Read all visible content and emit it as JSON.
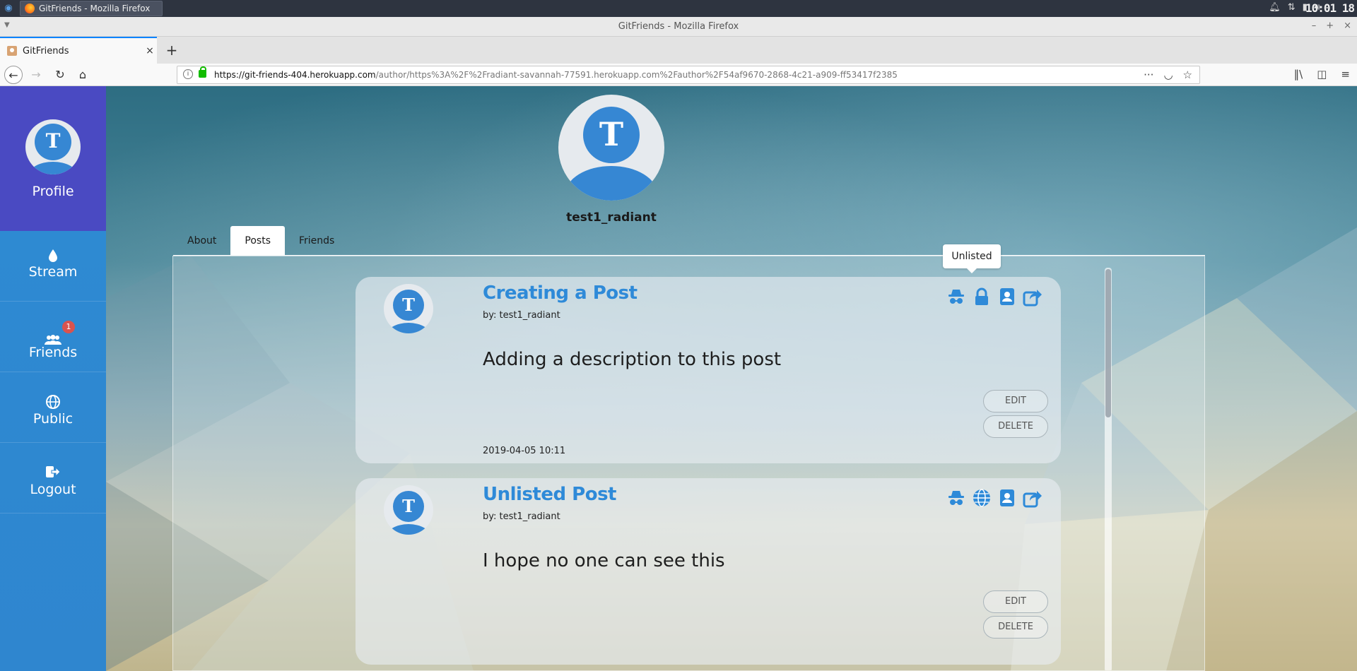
{
  "os": {
    "start_icon": "debian-swirl-icon",
    "task_label": "GitFriends - Mozilla Firefox",
    "clock": "10:01 18",
    "tray_icons": [
      "bell-icon",
      "network-arrows-icon",
      "battery-icon",
      "volume-icon"
    ]
  },
  "window": {
    "title": "GitFriends - Mozilla Firefox"
  },
  "browser": {
    "tab_title": "GitFriends",
    "url_domain": "https://git-friends-404.herokuapp.com",
    "url_path": "/author/https%3A%2F%2Fradiant-savannah-77591.herokuapp.com%2Fauthor%2F54af9670-2868-4c21-a909-ff53417f2385"
  },
  "sidebar": {
    "profile": {
      "label": "Profile",
      "avatar_letter": "T"
    },
    "items": [
      {
        "label": "Stream",
        "icon": "drop-icon"
      },
      {
        "label": "Friends",
        "icon": "users-icon",
        "badge": "1"
      },
      {
        "label": "Public",
        "icon": "globe-icon"
      },
      {
        "label": "Logout",
        "icon": "sign-out-icon"
      }
    ]
  },
  "profile": {
    "avatar_letter": "T",
    "username": "test1_radiant"
  },
  "tabs": [
    "About",
    "Posts",
    "Friends"
  ],
  "active_tab": "Posts",
  "tooltip": "Unlisted",
  "posts": [
    {
      "avatar_letter": "T",
      "title": "Creating a Post",
      "author": "by: test1_radiant",
      "body": "Adding a description to this post",
      "icons": [
        "incognito-icon",
        "lock-icon",
        "contact-card-icon",
        "share-icon"
      ],
      "edit_label": "EDIT",
      "delete_label": "DELETE",
      "date": "2019-04-05 10:11"
    },
    {
      "avatar_letter": "T",
      "title": "Unlisted Post",
      "author": "by: test1_radiant",
      "body": "I hope no one can see this",
      "icons": [
        "incognito-icon",
        "globe-icon",
        "contact-card-icon",
        "share-icon"
      ],
      "edit_label": "EDIT",
      "delete_label": "DELETE"
    }
  ],
  "colors": {
    "sidebar_blue": "#2d8bd3",
    "profile_purple": "#4a4ac2",
    "accent_blue": "#2e8ad8",
    "badge_red": "#d9534f"
  }
}
